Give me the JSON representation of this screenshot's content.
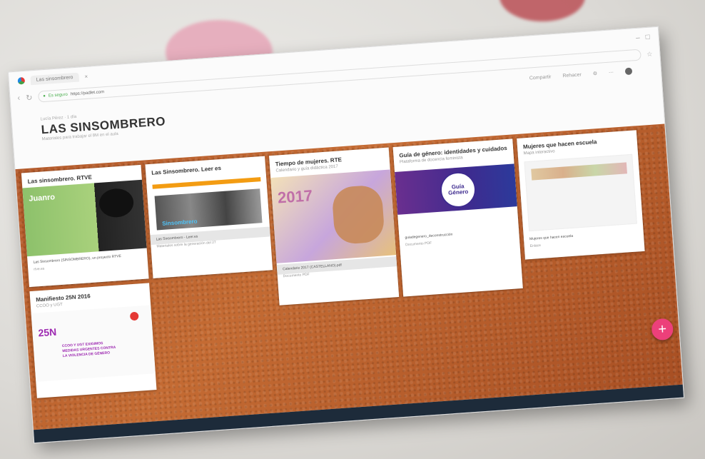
{
  "browser": {
    "tab_title": "Las sinsombrero",
    "url_secure": "Es seguro",
    "url": "https://padlet.com",
    "toolbar": {
      "share": "Compartir",
      "remake": "Rehacer"
    }
  },
  "padlet": {
    "breadcrumb": "Lucía Pérez · 1 día",
    "title": "LAS SINSOMBRERO",
    "subtitle": "Materiales para trabajar el 8M en el aula"
  },
  "cards": [
    {
      "title": "Las sinsombrero. RTVE",
      "thumb_logo": "Juanro",
      "foot": "Las Sinsombrero (SINSOMBRERO), un proyecto RTVE",
      "foot2": "rtve.es"
    },
    {
      "title": "Las Sinsombrero. Leer es",
      "foot": "Las Sinsombrero - Leer.es",
      "foot2": "Materiales sobre la generación del 27",
      "photo_text": "Sinsombrero"
    },
    {
      "title": "Tiempo de mujeres. RTE",
      "sub": "Calendario y guía didáctica 2017",
      "year": "2017",
      "foot": "Calendario 2017 (CASTELLANO).pdf",
      "foot2": "Documento PDF"
    },
    {
      "title": "Guía de género: identidades y cuidados",
      "sub": "Plataforma de docencia feminista",
      "badge": "Guía Género",
      "foot": "guiadegenero_deconstrucción",
      "foot2": "Documento PDF"
    },
    {
      "title": "Mujeres que hacen escuela",
      "sub": "Mapa interactivo",
      "foot": "Mujeres que hacen escuela",
      "foot2": "Enlace"
    },
    {
      "title": "Manifiesto 25N 2016",
      "sub": "CCOO y UGT",
      "big": "25N",
      "lines": "CCOO Y UGT EXIGIMOS\nMEDIDAS URGENTES CONTRA\nLA VIOLENCIA DE GÉNERO"
    }
  ],
  "fab": "+"
}
